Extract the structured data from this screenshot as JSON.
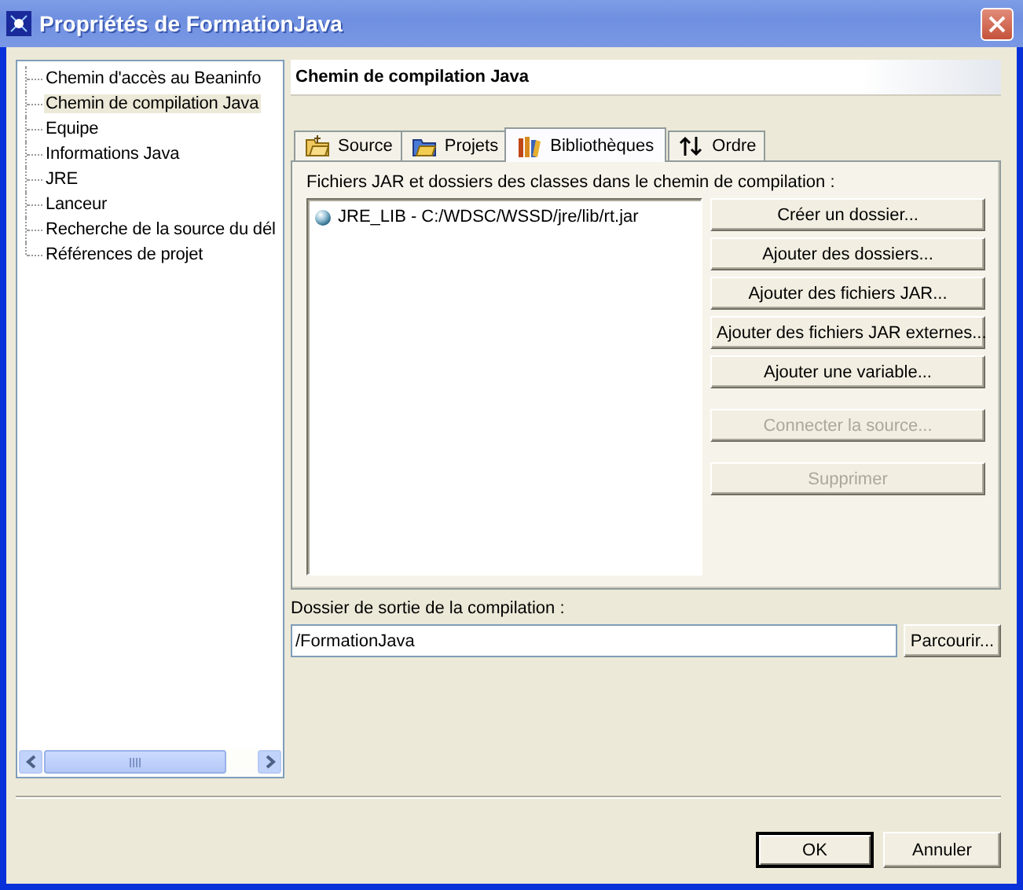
{
  "window": {
    "title": "Propriétés de FormationJava"
  },
  "sidebar": {
    "items": [
      {
        "label": "Chemin d'accès au Beaninfo",
        "selected": false
      },
      {
        "label": "Chemin de compilation Java",
        "selected": true
      },
      {
        "label": "Equipe",
        "selected": false
      },
      {
        "label": "Informations Java",
        "selected": false
      },
      {
        "label": "JRE",
        "selected": false
      },
      {
        "label": "Lanceur",
        "selected": false
      },
      {
        "label": "Recherche de la source du dél",
        "selected": false
      },
      {
        "label": "Références de projet",
        "selected": false
      }
    ]
  },
  "page": {
    "title": "Chemin de compilation Java"
  },
  "tabs": [
    {
      "label": "Source",
      "selected": false
    },
    {
      "label": "Projets",
      "selected": false
    },
    {
      "label": "Bibliothèques",
      "selected": true
    },
    {
      "label": "Ordre",
      "selected": false
    }
  ],
  "libraries": {
    "label": "Fichiers JAR et dossiers des classes dans le chemin de compilation :",
    "entries": [
      {
        "label": "JRE_LIB - C:/WDSC/WSSD/jre/lib/rt.jar"
      }
    ]
  },
  "buttons": [
    {
      "label": "Créer un dossier...",
      "disabled": false
    },
    {
      "label": "Ajouter des dossiers...",
      "disabled": false
    },
    {
      "label": "Ajouter des fichiers JAR...",
      "disabled": false
    },
    {
      "label": "Ajouter des fichiers JAR externes...",
      "disabled": false
    },
    {
      "label": "Ajouter une variable...",
      "disabled": false
    },
    {
      "label": "Connecter la source...",
      "disabled": true
    },
    {
      "label": "Supprimer",
      "disabled": true
    }
  ],
  "output": {
    "label": "Dossier de sortie de la compilation :",
    "value": "/FormationJava",
    "browse": {
      "label": "Parcourir..."
    }
  },
  "footer": {
    "buttons": [
      {
        "label": "OK",
        "default": true
      },
      {
        "label": "Annuler",
        "default": false
      }
    ]
  }
}
